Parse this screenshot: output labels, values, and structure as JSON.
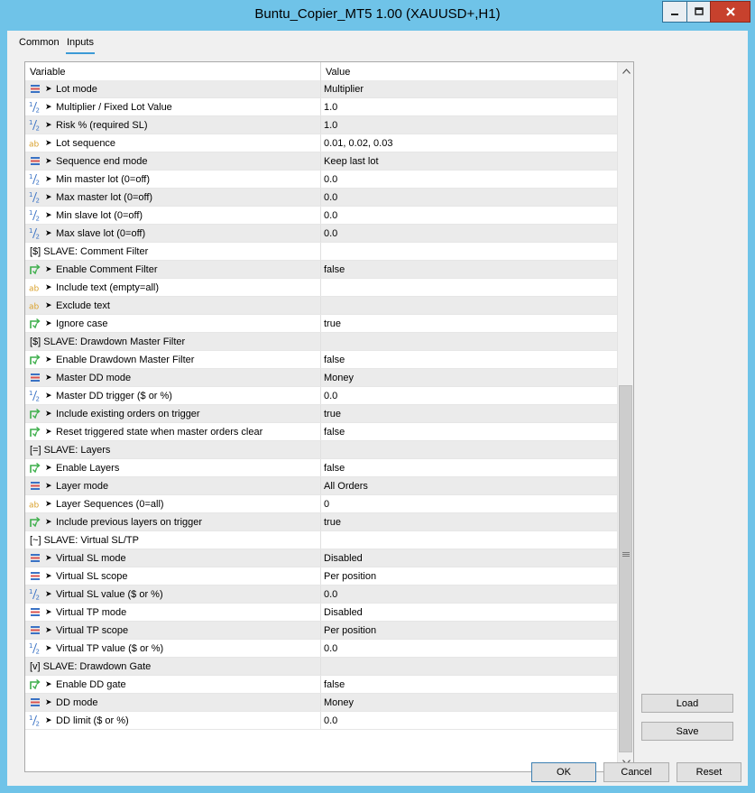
{
  "window": {
    "title": "Buntu_Copier_MT5 1.00 (XAUUSD+,H1)"
  },
  "tabs": [
    {
      "label": "Common"
    },
    {
      "label": "Inputs"
    }
  ],
  "grid": {
    "header_variable": "Variable",
    "header_value": "Value",
    "rows": [
      {
        "icon": "enum",
        "label": "Lot mode",
        "value": "Multiplier"
      },
      {
        "icon": "double",
        "label": "Multiplier / Fixed Lot Value",
        "value": "1.0"
      },
      {
        "icon": "double",
        "label": "Risk % (required SL)",
        "value": "1.0"
      },
      {
        "icon": "string",
        "label": "Lot sequence",
        "value": "0.01, 0.02, 0.03"
      },
      {
        "icon": "enum",
        "label": "Sequence end mode",
        "value": "Keep last lot"
      },
      {
        "icon": "double",
        "label": "Min master lot (0=off)",
        "value": "0.0"
      },
      {
        "icon": "double",
        "label": "Max master lot (0=off)",
        "value": "0.0"
      },
      {
        "icon": "double",
        "label": "Min slave lot (0=off)",
        "value": "0.0"
      },
      {
        "icon": "double",
        "label": "Max slave lot (0=off)",
        "value": "0.0"
      },
      {
        "icon": "none",
        "label": "[$] SLAVE: Comment Filter",
        "value": ""
      },
      {
        "icon": "bool",
        "label": "Enable Comment Filter",
        "value": "false"
      },
      {
        "icon": "string",
        "label": "Include text (empty=all)",
        "value": ""
      },
      {
        "icon": "string",
        "label": "Exclude text",
        "value": ""
      },
      {
        "icon": "bool",
        "label": "Ignore case",
        "value": "true"
      },
      {
        "icon": "none",
        "label": "[$] SLAVE: Drawdown Master Filter",
        "value": ""
      },
      {
        "icon": "bool",
        "label": "Enable Drawdown Master Filter",
        "value": "false"
      },
      {
        "icon": "enum",
        "label": "Master DD mode",
        "value": "Money"
      },
      {
        "icon": "double",
        "label": "Master DD trigger ($ or %)",
        "value": "0.0"
      },
      {
        "icon": "bool",
        "label": "Include existing orders on trigger",
        "value": "true"
      },
      {
        "icon": "bool",
        "label": "Reset triggered state when master orders clear",
        "value": "false"
      },
      {
        "icon": "none",
        "label": "[=] SLAVE: Layers",
        "value": ""
      },
      {
        "icon": "bool",
        "label": "Enable Layers",
        "value": "false"
      },
      {
        "icon": "enum",
        "label": "Layer mode",
        "value": "All Orders"
      },
      {
        "icon": "string",
        "label": "Layer Sequences (0=all)",
        "value": "0"
      },
      {
        "icon": "bool",
        "label": "Include previous layers on trigger",
        "value": "true"
      },
      {
        "icon": "none",
        "label": "[~] SLAVE: Virtual SL/TP",
        "value": ""
      },
      {
        "icon": "enum",
        "label": "Virtual SL mode",
        "value": "Disabled"
      },
      {
        "icon": "enum",
        "label": "Virtual SL scope",
        "value": "Per position"
      },
      {
        "icon": "double",
        "label": "Virtual SL value ($ or %)",
        "value": "0.0"
      },
      {
        "icon": "enum",
        "label": "Virtual TP mode",
        "value": "Disabled"
      },
      {
        "icon": "enum",
        "label": "Virtual TP scope",
        "value": "Per position"
      },
      {
        "icon": "double",
        "label": "Virtual TP value ($ or %)",
        "value": "0.0"
      },
      {
        "icon": "none",
        "label": "[v] SLAVE: Drawdown Gate",
        "value": ""
      },
      {
        "icon": "bool",
        "label": "Enable DD gate",
        "value": "false"
      },
      {
        "icon": "enum",
        "label": "DD mode",
        "value": "Money"
      },
      {
        "icon": "double",
        "label": "DD limit ($ or %)",
        "value": "0.0"
      }
    ]
  },
  "side_buttons": {
    "load": "Load",
    "save": "Save"
  },
  "footer_buttons": {
    "ok": "OK",
    "cancel": "Cancel",
    "reset": "Reset"
  },
  "colors": {
    "frame": "#6fc3e8",
    "close_button": "#c7412d",
    "tab_underline": "#3c9ad6",
    "row_alt": "#ebebeb"
  }
}
